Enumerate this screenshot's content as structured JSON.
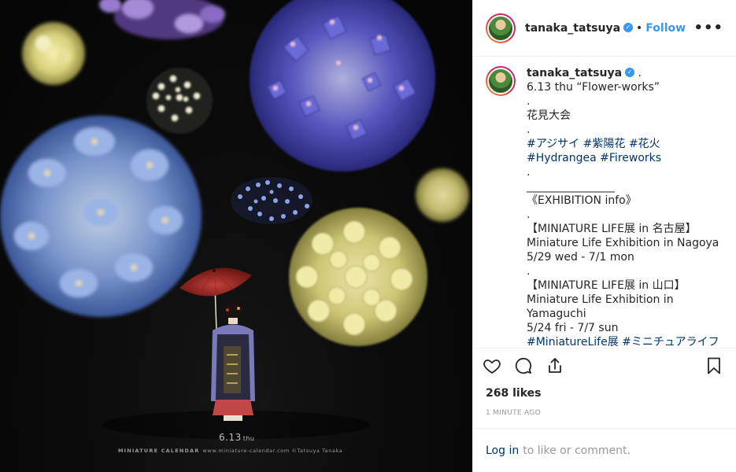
{
  "post": {
    "image": {
      "date_text": "6.13",
      "day_text": "thu",
      "brand": "MINIATURE CALENDAR",
      "credit": "www.miniature-calendar.com ©Tatsuya Tanaka"
    },
    "header": {
      "username": "tanaka_tatsuya",
      "verified_icon": "✓",
      "separator": "•",
      "follow_label": "Follow",
      "more_icon": "•••"
    },
    "caption": {
      "username": "tanaka_tatsuya",
      "verified_icon": "✓",
      "first_suffix": " .",
      "lines": [
        "6.13 thu “Flower-works”",
        ".",
        "花見大会",
        "."
      ],
      "hashtags_1": [
        "#アジサイ",
        "#紫陽花",
        "#花火"
      ],
      "hashtags_2": [
        "#Hydrangea",
        "#Fireworks"
      ],
      "lines_2": [
        ".",
        "________________",
        "《EXHIBITION info》",
        ".",
        "【MINIATURE LIFE展 in 名古屋】",
        "Miniature Life Exhibition in Nagoya",
        "5/29 wed - 7/1 mon",
        ".",
        "【MINIATURE LIFE展 in 山口】",
        "Miniature Life Exhibition in",
        "Yamaguchi",
        "5/24 fri - 7/7 sun"
      ],
      "hashtags_3": [
        "#MiniatureLife展",
        "#ミニチュアライフ"
      ]
    },
    "likes": "268 likes",
    "time": "1 MINUTE AGO",
    "login": {
      "link": "Log in",
      "text": "to like or comment."
    },
    "colors": {
      "link": "#003569",
      "accent": "#3897f0",
      "muted": "#999999"
    }
  }
}
